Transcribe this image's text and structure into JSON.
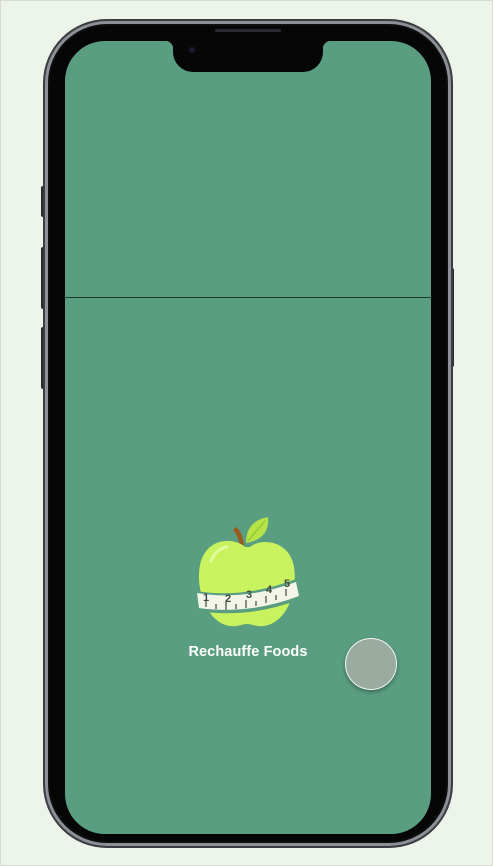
{
  "app": {
    "brand_name": "Rechauffe Foods"
  },
  "logo": {
    "icon": "apple-with-measuring-tape-icon",
    "tape_numbers": [
      "1",
      "2",
      "3",
      "4",
      "5"
    ]
  },
  "colors": {
    "screen_background": "#5a9e81",
    "apple_green": "#c8f25e",
    "leaf_green": "#b6e446",
    "stem_brown": "#9a5a1c",
    "tape_band": "#f3f5e9",
    "tape_edge": "#5a9e81",
    "fab": "#9aaba0",
    "page_background": "#edf5ea"
  },
  "fab": {
    "icon": "circle-button-icon"
  }
}
